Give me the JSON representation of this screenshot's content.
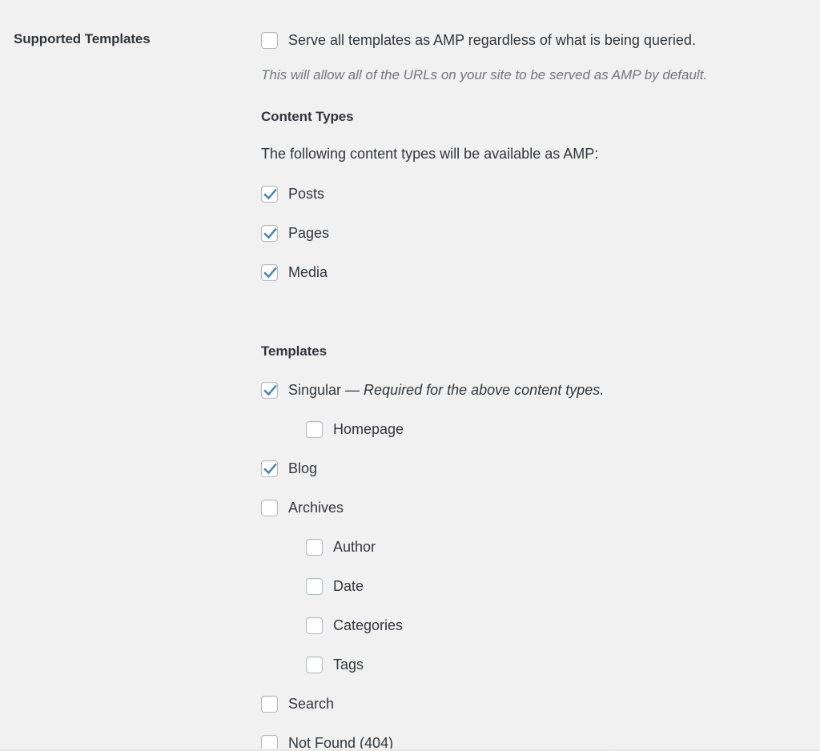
{
  "field": {
    "label": "Supported Templates"
  },
  "serve_all": {
    "label": "Serve all templates as AMP regardless of what is being queried.",
    "checked": false,
    "description": "This will allow all of the URLs on your site to be served as AMP by default."
  },
  "content_types": {
    "heading": "Content Types",
    "intro": "The following content types will be available as AMP:",
    "items": [
      {
        "label": "Posts",
        "checked": true
      },
      {
        "label": "Pages",
        "checked": true
      },
      {
        "label": "Media",
        "checked": true
      }
    ]
  },
  "templates": {
    "heading": "Templates",
    "items": [
      {
        "label": "Singular",
        "note": " — Required for the above content types.",
        "checked": true,
        "indent": false
      },
      {
        "label": "Homepage",
        "note": "",
        "checked": false,
        "indent": true
      },
      {
        "label": "Blog",
        "note": "",
        "checked": true,
        "indent": false
      },
      {
        "label": "Archives",
        "note": "",
        "checked": false,
        "indent": false
      },
      {
        "label": "Author",
        "note": "",
        "checked": false,
        "indent": true
      },
      {
        "label": "Date",
        "note": "",
        "checked": false,
        "indent": true
      },
      {
        "label": "Categories",
        "note": "",
        "checked": false,
        "indent": true
      },
      {
        "label": "Tags",
        "note": "",
        "checked": false,
        "indent": true
      },
      {
        "label": "Search",
        "note": "",
        "checked": false,
        "indent": false
      },
      {
        "label": "Not Found (404)",
        "note": "",
        "checked": false,
        "indent": false
      }
    ]
  },
  "colors": {
    "background": "#f1f1f1",
    "text": "#32373c",
    "muted_text": "#72777c",
    "checkmark": "#4a89b8",
    "checkbox_border": "#b4b9be"
  },
  "icons": {
    "checkmark": "checkmark-icon"
  }
}
